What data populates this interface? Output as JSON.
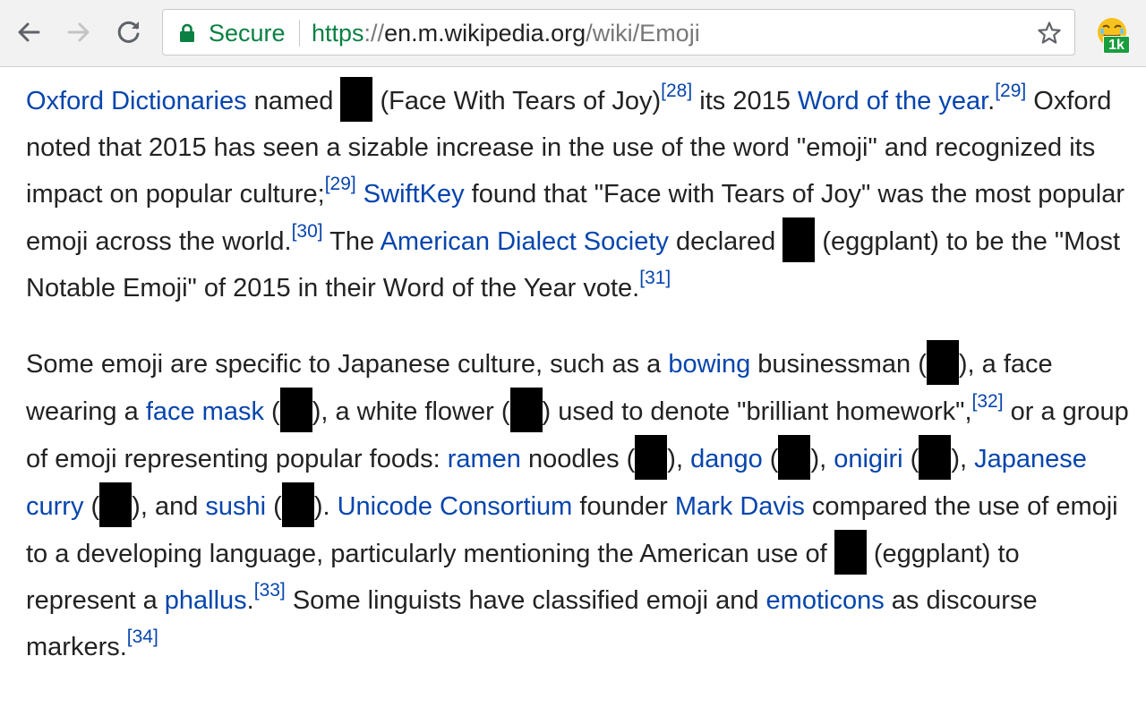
{
  "browser": {
    "secure_label": "Secure",
    "url": {
      "scheme": "https",
      "separator": "://",
      "host": "en.m.wikipedia.org",
      "path": "/wiki/Emoji"
    },
    "extension_badge": "1k",
    "icons": [
      "back-arrow-icon",
      "forward-arrow-icon",
      "reload-icon",
      "lock-icon",
      "star-icon",
      "emoji-extension-icon"
    ],
    "colors": {
      "secure": "#0b8043",
      "link": "#0645ad",
      "badge": "#1a9d3d"
    }
  },
  "article": {
    "p1": {
      "link_oxford": "Oxford Dictionaries",
      "t1": " named ",
      "t2": " (Face With Tears of Joy)",
      "ref28": "[28]",
      "t3": " its 2015 ",
      "link_woty": "Word of the year",
      "t4": ".",
      "ref29a": "[29]",
      "t5": " Oxford noted that 2015 has seen a sizable increase in the use of the word \"emoji\" and recognized its impact on popular culture;",
      "ref29b": "[29]",
      "t6": " ",
      "link_swiftkey": "SwiftKey",
      "t7": " found that \"Face with Tears of Joy\" was the most popular emoji across the world.",
      "ref30": "[30]",
      "t8": " The ",
      "link_ads": "American Dialect Society",
      "t9": " declared ",
      "t10": " (eggplant) to be the \"Most Notable Emoji\" of 2015 in their Word of the Year vote.",
      "ref31": "[31]"
    },
    "p2": {
      "t1": "Some emoji are specific to Japanese culture, such as a ",
      "link_bowing": "bowing",
      "t2": " businessman (",
      "t3": "), a face wearing a ",
      "link_facemask": "face mask",
      "t4": " (",
      "t5": "), a white flower (",
      "t6": ") used to denote \"brilliant homework\",",
      "ref32": "[32]",
      "t7": " or a group of emoji representing popular foods: ",
      "link_ramen": "ramen",
      "t8": " noodles (",
      "t9": "), ",
      "link_dango": "dango",
      "t10": " (",
      "t11": "), ",
      "link_onigiri": "onigiri",
      "t12": " (",
      "t13": "), ",
      "link_curry": "Japanese curry",
      "t14": " (",
      "t15": "), and ",
      "link_sushi": "sushi",
      "t16": " (",
      "t17": "). ",
      "link_unicode": "Unicode Consortium",
      "t18": " founder ",
      "link_markdavis": "Mark Davis",
      "t19": " compared the use of emoji to a developing language, particularly mentioning the American use of ",
      "t20": " (eggplant) to represent a ",
      "link_phallus": "phallus",
      "t21": ".",
      "ref33": "[33]",
      "t22": " Some linguists have classified emoji and ",
      "link_emoticons": "emoticons",
      "t23": " as discourse markers.",
      "ref34": "[34]"
    }
  }
}
